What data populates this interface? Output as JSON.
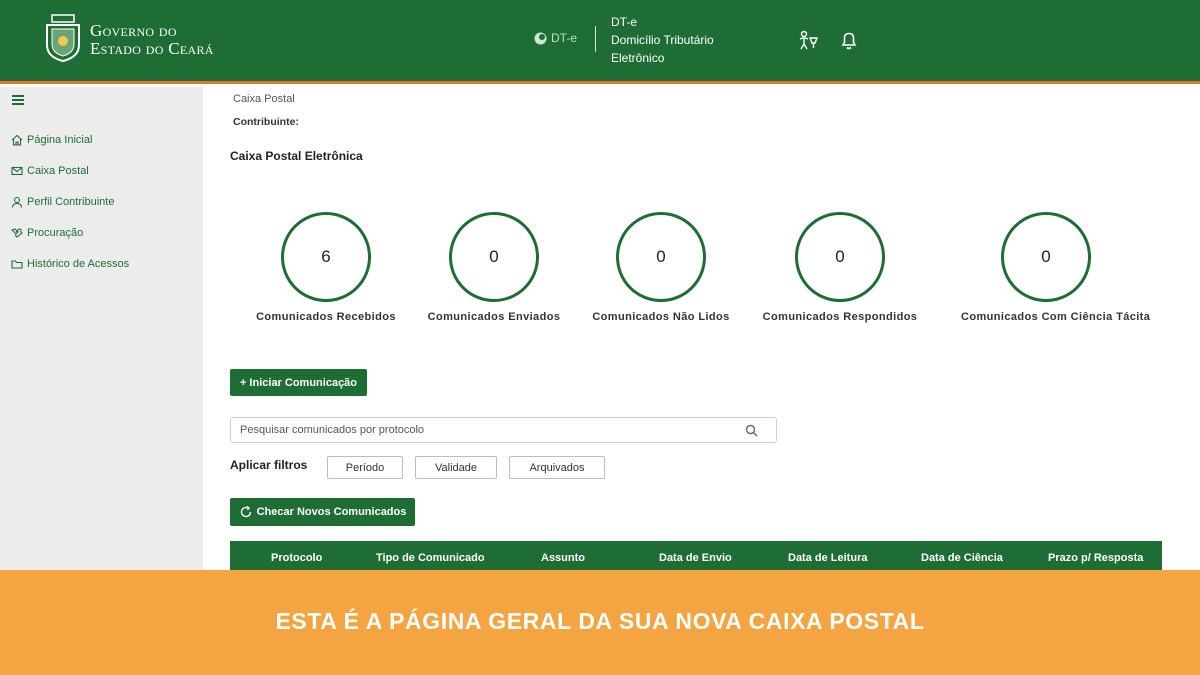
{
  "header": {
    "gov_line1": "Governo do",
    "gov_line2": "Estado do Ceará",
    "dte_mark": "DT-e",
    "dte_lines": [
      "DT-e",
      "Domicílio Tributário",
      "Eletrônico"
    ],
    "icons": [
      "accessibility-icon",
      "bell-icon"
    ]
  },
  "sidebar": {
    "items": [
      {
        "label": "Página Inicial",
        "icon": "home-icon"
      },
      {
        "label": "Caixa Postal",
        "icon": "mail-icon"
      },
      {
        "label": "Perfil Contribuinte",
        "icon": "user-icon"
      },
      {
        "label": "Procuração",
        "icon": "handshake-icon"
      },
      {
        "label": "Histórico de Acessos",
        "icon": "folder-icon"
      }
    ]
  },
  "main": {
    "breadcrumb": "Caixa Postal",
    "contribuinte_label": "Contribuinte:",
    "section_title": "Caixa Postal Eletrônica",
    "stats": [
      {
        "value": "6",
        "label": "Comunicados Recebidos"
      },
      {
        "value": "0",
        "label": "Comunicados Enviados"
      },
      {
        "value": "0",
        "label": "Comunicados Não Lidos"
      },
      {
        "value": "0",
        "label": "Comunicados Respondidos"
      },
      {
        "value": "0",
        "label": "Comunicados Com Ciência Tácita"
      }
    ],
    "iniciar_button": "+ Iniciar Comunicação",
    "search_placeholder": "Pesquisar comunicados por protocolo",
    "filters_label": "Aplicar filtros",
    "filters": [
      "Período",
      "Validade",
      "Arquivados"
    ],
    "checar_button": "Checar Novos Comunicados",
    "table_headers": [
      "Protocolo",
      "Tipo de Comunicado",
      "Assunto",
      "Data de Envio",
      "Data de Leitura",
      "Data de Ciência",
      "Prazo p/ Resposta"
    ]
  },
  "banner": {
    "text": "ESTA É A PÁGINA GERAL DA SUA NOVA CAIXA POSTAL"
  },
  "colors": {
    "primary_green": "#1e6d35",
    "accent_orange": "#e8742a",
    "banner_orange": "#f4a440",
    "sidebar_bg": "#ececec"
  }
}
